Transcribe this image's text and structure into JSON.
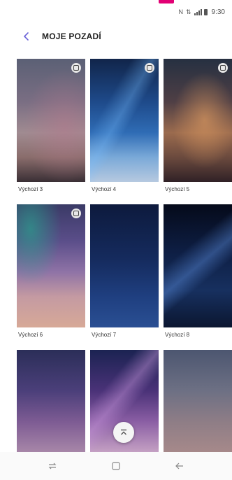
{
  "status_bar": {
    "time": "9:30"
  },
  "app_bar": {
    "title": "MOJE POZADÍ"
  },
  "wallpapers": [
    {
      "label": "Výchozí 3",
      "badge": true
    },
    {
      "label": "Výchozí 4",
      "badge": true
    },
    {
      "label": "Výchozí 5",
      "badge": true
    },
    {
      "label": "Výchozí 6",
      "badge": true
    },
    {
      "label": "Výchozí 7",
      "badge": false
    },
    {
      "label": "Výchozí 8",
      "badge": false
    },
    {
      "label": "",
      "badge": false
    },
    {
      "label": "",
      "badge": false
    },
    {
      "label": "",
      "badge": false
    }
  ],
  "colors": {
    "back_arrow": "#6b63d8",
    "accent": "#e20074"
  },
  "icons": {
    "back": "chevron-left-icon",
    "scroll_top": "scroll-to-top-icon",
    "nav_recent": "recent-apps-icon",
    "nav_home": "home-icon",
    "nav_back": "back-arrow-icon"
  }
}
